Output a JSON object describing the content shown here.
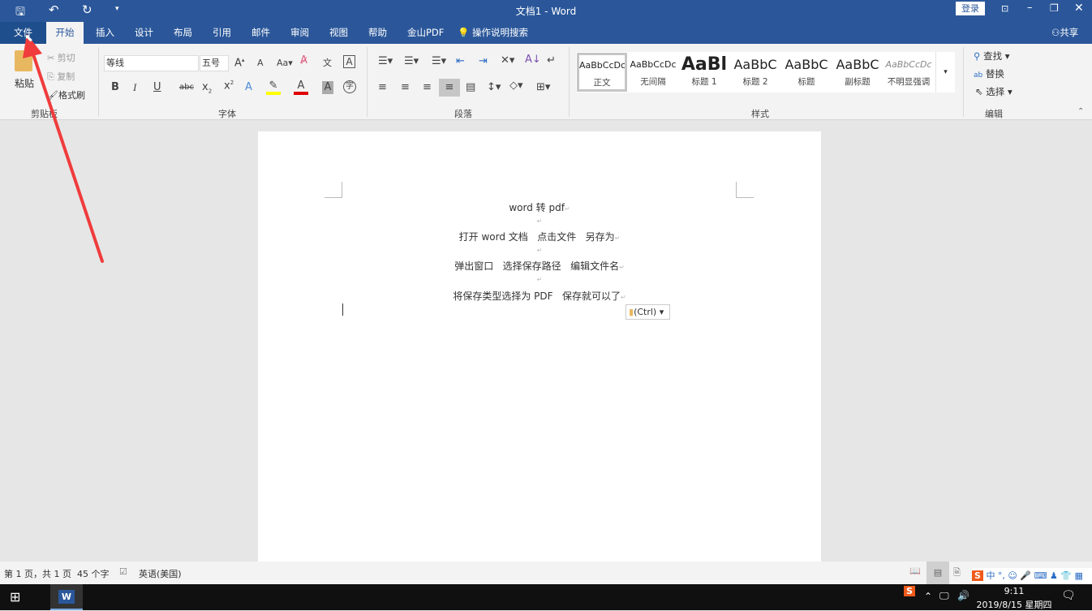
{
  "title": "文档1  -  Word",
  "titlebar": {
    "login": "登录",
    "quick_access": [
      "save-icon",
      "undo-icon",
      "redo-icon",
      "customize-icon"
    ]
  },
  "tabs": [
    {
      "label": "文件"
    },
    {
      "label": "开始"
    },
    {
      "label": "插入"
    },
    {
      "label": "设计"
    },
    {
      "label": "布局"
    },
    {
      "label": "引用"
    },
    {
      "label": "邮件"
    },
    {
      "label": "审阅"
    },
    {
      "label": "视图"
    },
    {
      "label": "帮助"
    },
    {
      "label": "金山PDF"
    },
    {
      "label": "操作说明搜索"
    }
  ],
  "share": "共享",
  "ribbon": {
    "clipboard": {
      "paste": "粘贴",
      "cut": "剪切",
      "copy": "复制",
      "format_painter": "格式刷",
      "label": "剪贴板"
    },
    "font": {
      "font_name": "等线",
      "font_size": "五号",
      "label": "字体",
      "highlight_color": "#ffff00",
      "font_color": "#e00000"
    },
    "paragraph": {
      "label": "段落"
    },
    "styles": {
      "items": [
        {
          "preview": "AaBbCcDc",
          "name": "正文"
        },
        {
          "preview": "AaBbCcDc",
          "name": "无间隔"
        },
        {
          "preview": "AaBl",
          "name": "标题 1"
        },
        {
          "preview": "AaBbC",
          "name": "标题 2"
        },
        {
          "preview": "AaBbC",
          "name": "标题"
        },
        {
          "preview": "AaBbC",
          "name": "副标题"
        },
        {
          "preview": "AaBbCcDc",
          "name": "不明显强调"
        }
      ],
      "label": "样式"
    },
    "editing": {
      "find": "查找",
      "replace": "替换",
      "select": "选择",
      "label": "编辑"
    }
  },
  "document": {
    "lines": [
      "word 转 pdf",
      "打开 word 文档   点击文件   另存为",
      "弹出窗口   选择保存路径   编辑文件名",
      "将保存类型选择为 PDF   保存就可以了"
    ],
    "paste_options": "(Ctrl)"
  },
  "statusbar": {
    "page": "第 1 页，共 1 页",
    "words": "45 个字",
    "language": "英语(美国)"
  },
  "ime": {
    "mode": "中"
  },
  "taskbar": {
    "time": "9:11",
    "date": "2019/8/15 星期四"
  }
}
